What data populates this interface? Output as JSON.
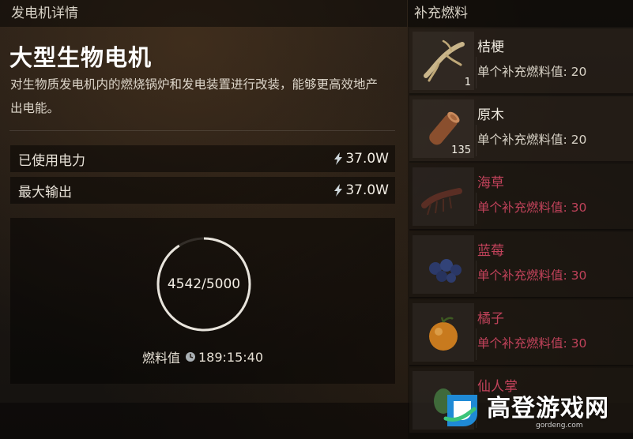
{
  "left_panel": {
    "header": "发电机详情",
    "title": "大型生物电机",
    "description": "对生物质发电机内的燃烧锅炉和发电装置进行改装，能够更高效地产出电能。",
    "stats": [
      {
        "label": "已使用电力",
        "value": "37.0W"
      },
      {
        "label": "最大输出",
        "value": "37.0W"
      }
    ],
    "fuel": {
      "current": 4542,
      "max": 5000,
      "display": "4542/5000",
      "label": "燃料值",
      "time": "189:15:40"
    }
  },
  "right_panel": {
    "header": "补充燃料",
    "items": [
      {
        "name": "桔梗",
        "value_text": "单个补充燃料值: 20",
        "qty": "1",
        "icon": "root-icon",
        "available": true
      },
      {
        "name": "原木",
        "value_text": "单个补充燃料值: 20",
        "qty": "135",
        "icon": "log-icon",
        "available": true
      },
      {
        "name": "海草",
        "value_text": "单个补充燃料值: 30",
        "qty": "",
        "icon": "seaweed-icon",
        "available": false
      },
      {
        "name": "蓝莓",
        "value_text": "单个补充燃料值: 30",
        "qty": "",
        "icon": "blueberry-icon",
        "available": false
      },
      {
        "name": "橘子",
        "value_text": "单个补充燃料值: 30",
        "qty": "",
        "icon": "orange-icon",
        "available": false
      },
      {
        "name": "仙人掌",
        "value_text": "",
        "qty": "",
        "icon": "cactus-icon",
        "available": false
      }
    ]
  },
  "watermark": {
    "text": "高登游戏网",
    "sub": "gordeng.com"
  },
  "colors": {
    "unavailable": "#c0425a",
    "accent_ring": "#e8e4dc"
  }
}
